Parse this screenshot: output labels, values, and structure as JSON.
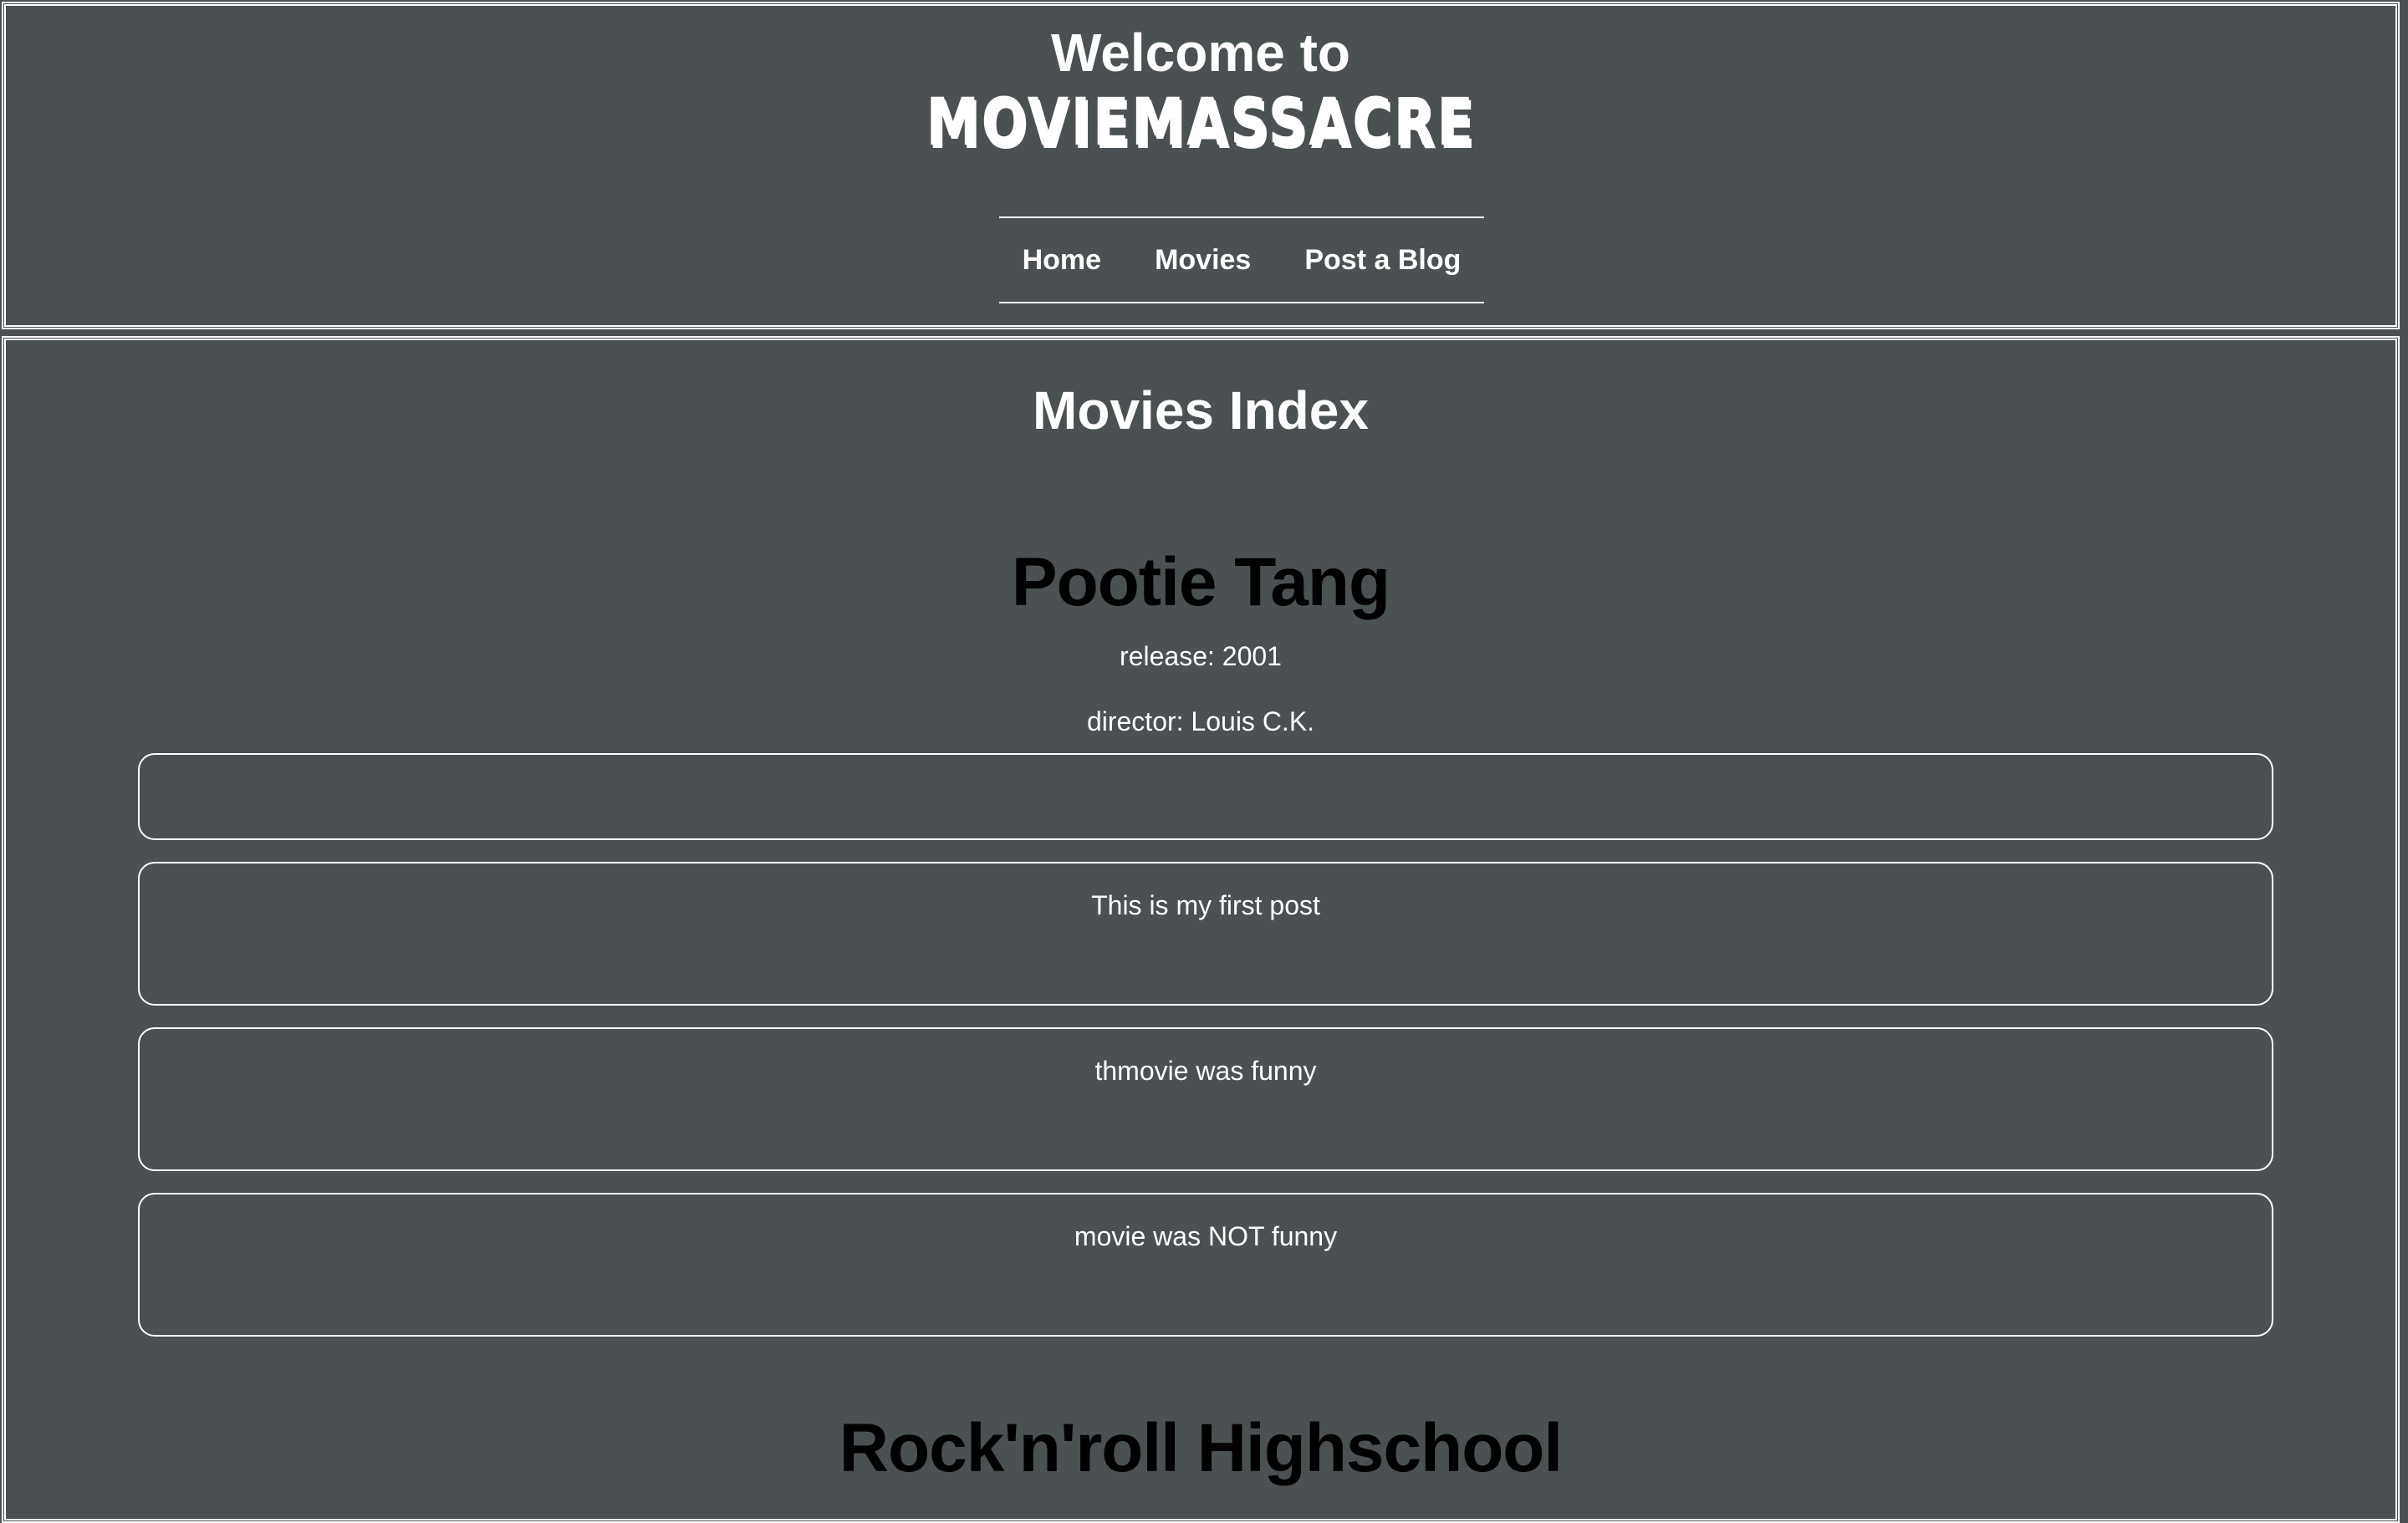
{
  "header": {
    "welcome": "Welcome to",
    "logo": "MOVIEMASSACRE",
    "nav": [
      "Home",
      "Movies",
      "Post a Blog"
    ]
  },
  "main": {
    "title": "Movies Index",
    "movies": [
      {
        "title": "Pootie Tang",
        "release": "release: 2001",
        "director": "director: Louis C.K.",
        "posts": [
          "",
          "This is my first post",
          "thmovie was funny",
          "movie was NOT funny"
        ]
      },
      {
        "title": "Rock'n'roll Highschool"
      }
    ]
  },
  "colors": {
    "background": "#4b5053",
    "text": "#ffffff",
    "movie_title": "#000000"
  }
}
